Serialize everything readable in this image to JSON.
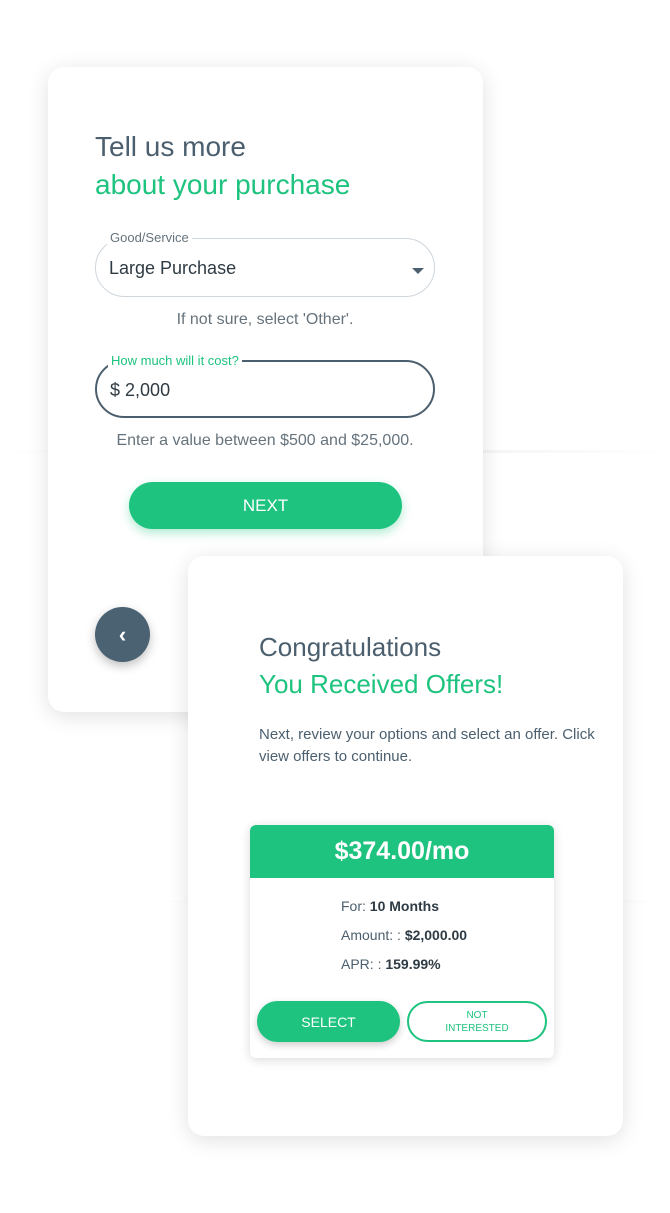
{
  "form_card": {
    "heading_line1": "Tell us more",
    "heading_line2": "about your purchase",
    "good_service": {
      "label": "Good/Service",
      "value": "Large Purchase",
      "helper": "If not sure, select 'Other'."
    },
    "cost": {
      "label": "How much will it cost?",
      "currency": "$",
      "value": "2,000",
      "helper": "Enter a value between $500 and $25,000."
    },
    "next_label": "NEXT",
    "back_glyph": "‹"
  },
  "offers_card": {
    "heading_line1": "Congratulations",
    "heading_line2": "You Received Offers!",
    "description": "Next, review your options and select an offer. Click view offers to continue.",
    "offer": {
      "price": "$374.00/mo",
      "for_label": "For: ",
      "for_value": "10 Months",
      "amount_label": "Amount: : ",
      "amount_value": "$2,000.00",
      "apr_label": "APR: : ",
      "apr_value": "159.99%",
      "select_label": "SELECT",
      "not_interested_line1": "NOT",
      "not_interested_line2": "INTERESTED"
    }
  },
  "colors": {
    "accent": "#1dc37e",
    "text_dark": "#4b5f6e",
    "back_button": "#4b6272"
  }
}
